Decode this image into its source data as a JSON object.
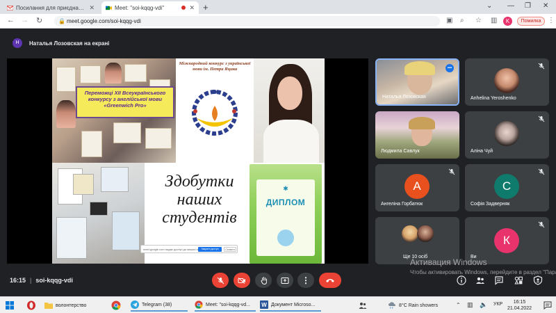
{
  "browser": {
    "tabs": [
      {
        "title": "Посилання для приєднання до...",
        "active": false
      },
      {
        "title": "Meet: \"soi-kqqg-vdi\"",
        "active": true
      }
    ],
    "url": "meet.google.com/soi-kqqg-vdi",
    "profile_initial": "K",
    "error_label": "Помилка"
  },
  "meet": {
    "presenter_banner": "Наталья Лозовская на екрані",
    "presenter_initial": "Н",
    "meeting_time": "16:15",
    "meeting_code": "soi-kqqg-vdi"
  },
  "slide": {
    "box_text": "Переможці XII Всеукраїнського конкурсу з англійської мови «Greenwich Pro»",
    "competition_title": "Міжнародний конкурс з української мови ім. Петра Яцика",
    "main_text": "Здобутки наших студентів",
    "diploma_title": "ДИПЛОМ",
    "share_text": "meet.google.com надає доступ до вашого екрана.",
    "share_stop": "Закрити доступ",
    "share_hide": "Сховати"
  },
  "participants": [
    {
      "name": "Наталья Лозовская",
      "type": "video",
      "speaking": true
    },
    {
      "name": "Anhelina Yeroshenko",
      "type": "photo"
    },
    {
      "name": "Людмила Савлук",
      "type": "video"
    },
    {
      "name": "Аліна Чуй",
      "type": "photo"
    },
    {
      "name": "Ангеліна Горбатюк",
      "type": "letter",
      "letter": "А",
      "color": "#e8501e"
    },
    {
      "name": "Софія Задверняк",
      "type": "letter",
      "letter": "С",
      "color": "#0f7b6c"
    },
    {
      "name": "Ще 10 осіб",
      "type": "group"
    },
    {
      "name": "Ви",
      "type": "letter",
      "letter": "К",
      "color": "#e8336d"
    }
  ],
  "windows": {
    "activation_title": "Активация Windows",
    "activation_text": "Чтобы активировать Windows, перейдите в раздел \"Параметры\"."
  },
  "taskbar": {
    "items": [
      {
        "label": "волонтерство",
        "open": false
      },
      {
        "label": "Telegram (38)",
        "open": true
      },
      {
        "label": "Meet: \"soi-kqqg-vd...",
        "open": true
      },
      {
        "label": "Документ Microso...",
        "open": true
      }
    ],
    "weather": "8°C Rain showers",
    "lang": "УКР",
    "time": "16:15",
    "date": "21.04.2022"
  }
}
